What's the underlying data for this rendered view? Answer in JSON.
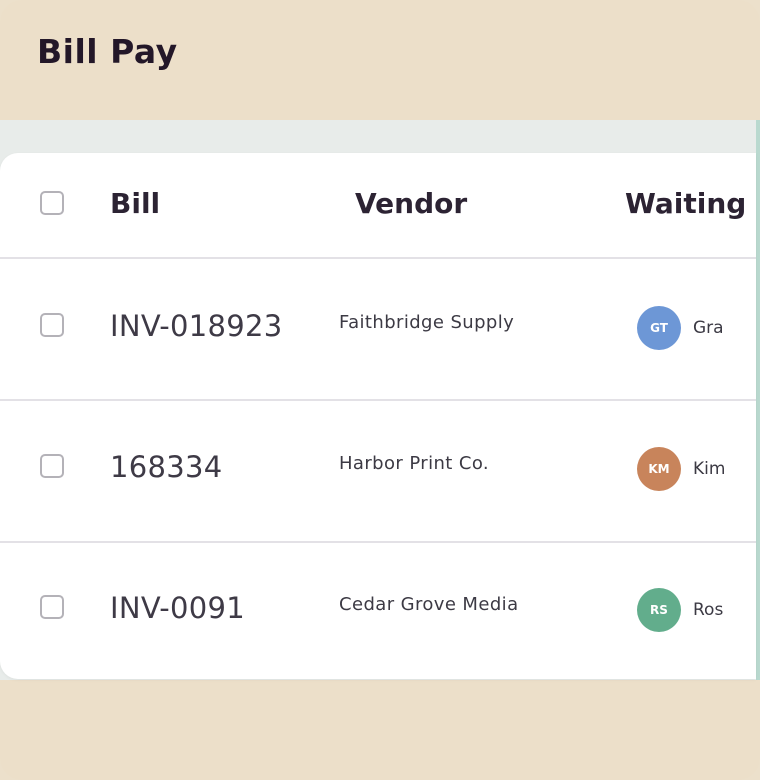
{
  "header": {
    "title": "Bill Pay"
  },
  "table": {
    "columns": [
      "Bill",
      "Vendor",
      "Waiting o"
    ],
    "rows": [
      {
        "bill": "INV-018923",
        "vendor": "Faithbridge Supply",
        "initials": "GT",
        "assignee": "Gra",
        "avatar_color": "#6d97d6"
      },
      {
        "bill": "168334",
        "vendor": "Harbor Print Co.",
        "initials": "KM",
        "assignee": "Kim",
        "avatar_color": "#c8845b"
      },
      {
        "bill": "INV-0091",
        "vendor": "Cedar Grove Media",
        "initials": "RS",
        "assignee": "Ros",
        "avatar_color": "#62ad8c"
      }
    ]
  }
}
